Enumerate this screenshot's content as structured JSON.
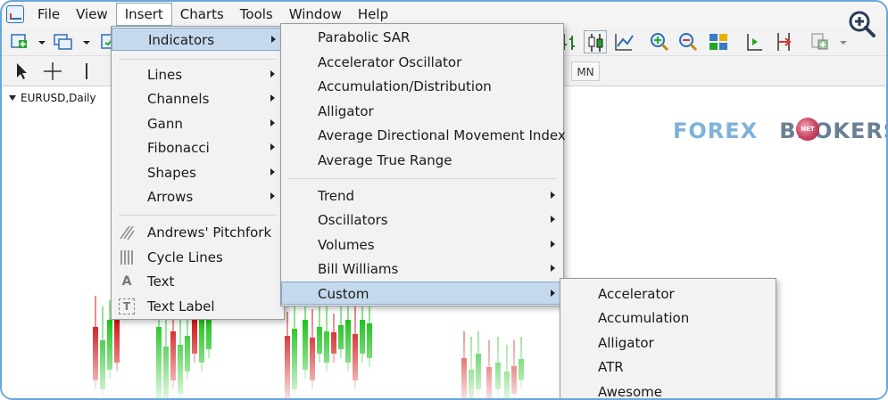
{
  "menubar": {
    "items": [
      "File",
      "View",
      "Insert",
      "Charts",
      "Tools",
      "Window",
      "Help"
    ],
    "active": "Insert"
  },
  "toolbar": {
    "period_label": "MN"
  },
  "chart": {
    "title": "EURUSD,Daily",
    "brand_part1": "FOREX",
    "brand_part2": "BROKERS",
    "brand_badge": "NET",
    "bull_color": "#22c422",
    "bear_color": "#d11a1a"
  },
  "insert_menu": {
    "items": [
      {
        "label": "Indicators",
        "submenu": true
      },
      {
        "label": "Lines",
        "submenu": true
      },
      {
        "label": "Channels",
        "submenu": true
      },
      {
        "label": "Gann",
        "submenu": true
      },
      {
        "label": "Fibonacci",
        "submenu": true
      },
      {
        "label": "Shapes",
        "submenu": true
      },
      {
        "label": "Arrows",
        "submenu": true
      },
      {
        "label": "Andrews' Pitchfork",
        "icon": "pitchfork-icon"
      },
      {
        "label": "Cycle Lines",
        "icon": "cycle-lines-icon"
      },
      {
        "label": "Text",
        "icon": "text-icon"
      },
      {
        "label": "Text Label",
        "icon": "text-label-icon"
      }
    ]
  },
  "indicators_menu": {
    "items": [
      {
        "label": "Parabolic SAR"
      },
      {
        "label": "Accelerator Oscillator"
      },
      {
        "label": "Accumulation/Distribution"
      },
      {
        "label": "Alligator"
      },
      {
        "label": "Average Directional Movement Index"
      },
      {
        "label": "Average True Range"
      },
      {
        "label": "Trend",
        "submenu": true
      },
      {
        "label": "Oscillators",
        "submenu": true
      },
      {
        "label": "Volumes",
        "submenu": true
      },
      {
        "label": "Bill Williams",
        "submenu": true
      },
      {
        "label": "Custom",
        "submenu": true
      }
    ]
  },
  "custom_menu": {
    "items": [
      "Accelerator",
      "Accumulation",
      "Alligator",
      "ATR",
      "Awesome"
    ]
  }
}
